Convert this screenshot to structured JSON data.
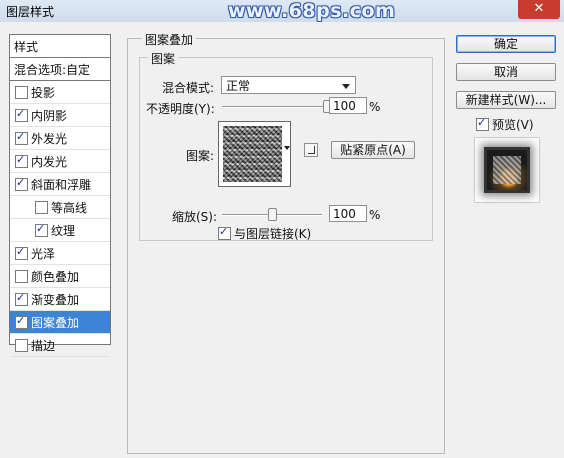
{
  "window": {
    "title": "图层样式",
    "watermark": "www.68ps.com",
    "close_glyph": "✕"
  },
  "style_list": {
    "header": "样式",
    "blend_options": "混合选项:自定",
    "items": [
      {
        "label": "投影",
        "checked": false,
        "sub": false,
        "selected": false
      },
      {
        "label": "内阴影",
        "checked": true,
        "sub": false,
        "selected": false
      },
      {
        "label": "外发光",
        "checked": true,
        "sub": false,
        "selected": false
      },
      {
        "label": "内发光",
        "checked": true,
        "sub": false,
        "selected": false
      },
      {
        "label": "斜面和浮雕",
        "checked": true,
        "sub": false,
        "selected": false
      },
      {
        "label": "等高线",
        "checked": false,
        "sub": true,
        "selected": false
      },
      {
        "label": "纹理",
        "checked": true,
        "sub": true,
        "selected": false
      },
      {
        "label": "光泽",
        "checked": true,
        "sub": false,
        "selected": false
      },
      {
        "label": "颜色叠加",
        "checked": false,
        "sub": false,
        "selected": false
      },
      {
        "label": "渐变叠加",
        "checked": true,
        "sub": false,
        "selected": false
      },
      {
        "label": "图案叠加",
        "checked": true,
        "sub": false,
        "selected": true
      },
      {
        "label": "描边",
        "checked": false,
        "sub": false,
        "selected": false
      }
    ]
  },
  "pattern_overlay": {
    "group_title": "图案叠加",
    "inner_title": "图案",
    "blend_mode_label": "混合模式:",
    "blend_mode_value": "正常",
    "opacity_label": "不透明度(Y):",
    "opacity_value": "100",
    "opacity_unit": "%",
    "opacity_percent": 100,
    "pattern_label": "图案:",
    "snap_origin_button": "贴紧原点(A)",
    "scale_label": "缩放(S):",
    "scale_value": "100",
    "scale_unit": "%",
    "scale_percent": 100,
    "link_layer_label": "与图层链接(K)",
    "link_layer_checked": true
  },
  "buttons": {
    "ok": "确定",
    "cancel": "取消",
    "new_style": "新建样式(W)...",
    "preview_label": "预览(V)",
    "preview_checked": true
  },
  "colors": {
    "selection": "#3d83d6",
    "close_button": "#c73c2e",
    "title_bar": "#d7e3f2"
  }
}
